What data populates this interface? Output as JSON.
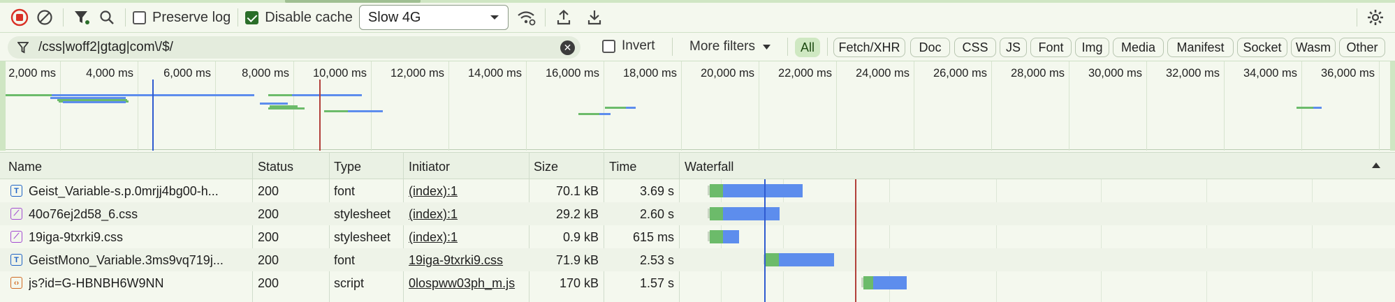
{
  "toolbar": {
    "preserve_log_label": "Preserve log",
    "disable_cache_label": "Disable cache",
    "throttle_value": "Slow 4G"
  },
  "filter": {
    "value": "/css|woff2|gtag|com\\/$/",
    "invert_label": "Invert",
    "more_filters_label": "More filters",
    "types": [
      "All",
      "Fetch/XHR",
      "Doc",
      "CSS",
      "JS",
      "Font",
      "Img",
      "Media",
      "Manifest",
      "Socket",
      "Wasm",
      "Other"
    ]
  },
  "overview": {
    "ticks": [
      "2,000 ms",
      "4,000 ms",
      "6,000 ms",
      "8,000 ms",
      "10,000 ms",
      "12,000 ms",
      "14,000 ms",
      "16,000 ms",
      "18,000 ms",
      "20,000 ms",
      "22,000 ms",
      "24,000 ms",
      "26,000 ms",
      "28,000 ms",
      "30,000 ms",
      "32,000 ms",
      "34,000 ms",
      "36,000 ms"
    ]
  },
  "table": {
    "headers": {
      "name": "Name",
      "status": "Status",
      "type": "Type",
      "initiator": "Initiator",
      "size": "Size",
      "time": "Time",
      "waterfall": "Waterfall"
    },
    "rows": [
      {
        "name": "Geist_Variable-s.p.0mrjj4bg00-h...",
        "status": "200",
        "type": "font",
        "initiator": "(index):1",
        "size": "70.1 kB",
        "time": "3.69 s",
        "icon": "font-file-icon"
      },
      {
        "name": "40o76ej2d58_6.css",
        "status": "200",
        "type": "stylesheet",
        "initiator": "(index):1",
        "size": "29.2 kB",
        "time": "2.60 s",
        "icon": "stylesheet-file-icon"
      },
      {
        "name": "19iga-9txrki9.css",
        "status": "200",
        "type": "stylesheet",
        "initiator": "(index):1",
        "size": "0.9 kB",
        "time": "615 ms",
        "icon": "stylesheet-file-icon"
      },
      {
        "name": "GeistMono_Variable.3ms9vq719j...",
        "status": "200",
        "type": "font",
        "initiator": "19iga-9txrki9.css",
        "size": "71.9 kB",
        "time": "2.53 s",
        "icon": "font-file-icon"
      },
      {
        "name": "js?id=G-HBNBH6W9NN",
        "status": "200",
        "type": "script",
        "initiator": "0lospww03ph_m.js",
        "size": "170 kB",
        "time": "1.57 s",
        "icon": "script-file-icon"
      }
    ]
  },
  "colors": {
    "waiting": "#6cbb6a",
    "download": "#5d8ded",
    "dom_content_loaded_line": "#2f5bd0",
    "load_line": "#b2403a"
  }
}
